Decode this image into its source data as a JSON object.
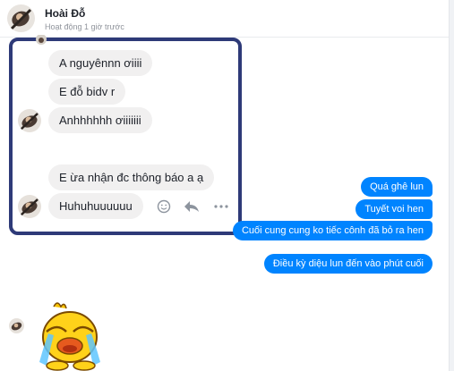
{
  "header": {
    "contact_name": "Hoài Đỗ",
    "status": "Hoạt động 1 giờ trước"
  },
  "incoming_messages": [
    "A nguyênnn ơiiii",
    "E đỗ bidv r",
    "Anhhhhhh ơiiiiiii",
    "E ừa nhận đc thông báo a ạ",
    "Huhuhuuuuuu"
  ],
  "outgoing_messages": [
    "Quá ghê lun",
    "Tuyết voi hen",
    "Cuối cung cung ko tiếc cônh đã bỏ ra hen",
    "Điều kỳ diệu lun đến vào phút cuối"
  ],
  "message_actions": {
    "react_icon": "smiley-icon",
    "reply_icon": "reply-arrow-icon",
    "more_icon": "more-dots-icon"
  },
  "sticker": "crying-yellow-duck-sticker",
  "colors": {
    "accent": "#0084ff",
    "incoming_bg": "#f1f0f0",
    "highlight_border": "#2e3a78"
  }
}
